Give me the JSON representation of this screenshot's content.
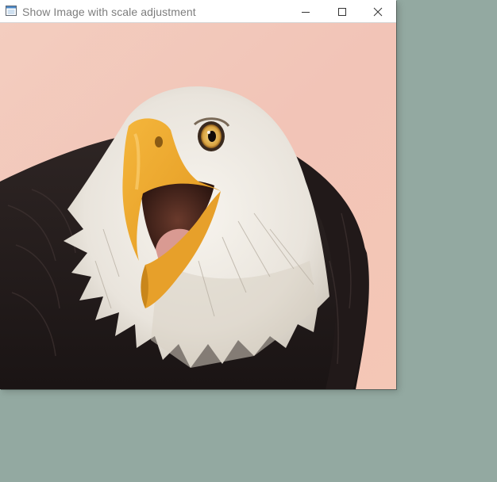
{
  "window": {
    "title": "Show Image with scale adjustment",
    "controls": {
      "minimize_icon": "minimize-icon",
      "maximize_icon": "maximize-icon",
      "close_icon": "close-icon"
    }
  },
  "image": {
    "subject": "bald eagle",
    "background_color": "#f2c6b8"
  },
  "desktop": {
    "background_color": "#93a9a1"
  }
}
